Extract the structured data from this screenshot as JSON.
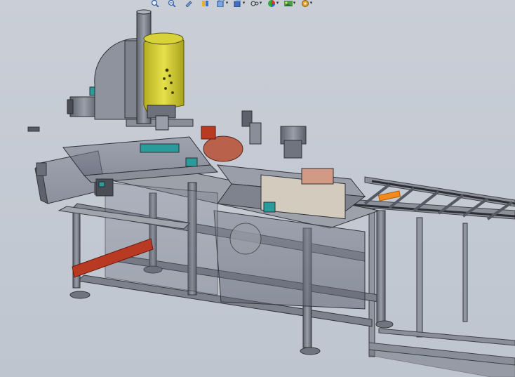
{
  "toolbar": {
    "items": [
      {
        "icon": "zoom-to-fit-icon",
        "dropdown": false
      },
      {
        "icon": "zoom-to-area-icon",
        "dropdown": false
      },
      {
        "icon": "previous-view-icon",
        "dropdown": false
      },
      {
        "icon": "section-view-icon",
        "dropdown": false
      },
      {
        "icon": "view-orientation-icon",
        "dropdown": true
      },
      {
        "icon": "display-style-icon",
        "dropdown": true
      },
      {
        "icon": "hide-show-items-icon",
        "dropdown": true
      },
      {
        "icon": "edit-appearance-icon",
        "dropdown": true
      },
      {
        "icon": "apply-scene-icon",
        "dropdown": true
      },
      {
        "icon": "view-settings-icon",
        "dropdown": true
      }
    ]
  },
  "colors": {
    "background": "#c6ccd5",
    "frame": "#8a8e98",
    "frame_dark": "#4a4d55",
    "motor_yellow": "#d8d23a",
    "accent_red": "#b83a22",
    "blade": "#b9614a",
    "teal": "#2a9a9a",
    "orange": "#f08a1c"
  }
}
